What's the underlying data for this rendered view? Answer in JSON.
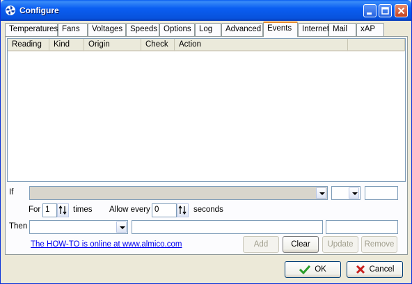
{
  "window": {
    "title": "Configure"
  },
  "tabs": [
    {
      "label": "Temperatures"
    },
    {
      "label": "Fans"
    },
    {
      "label": "Voltages"
    },
    {
      "label": "Speeds"
    },
    {
      "label": "Options"
    },
    {
      "label": "Log"
    },
    {
      "label": "Advanced"
    },
    {
      "label": "Events",
      "active": true
    },
    {
      "label": "Internet"
    },
    {
      "label": "Mail"
    },
    {
      "label": "xAP"
    }
  ],
  "list": {
    "columns": [
      "Reading",
      "Kind",
      "Origin",
      "Check",
      "Action"
    ]
  },
  "if_row": {
    "label": "If"
  },
  "for_row": {
    "for_label": "For",
    "for_value": "1",
    "times_label": "times",
    "allow_label": "Allow every",
    "allow_value": "0",
    "seconds_label": "seconds"
  },
  "then_row": {
    "label": "Then"
  },
  "howto_link": "The HOW-TO is online at www.almico.com",
  "buttons": {
    "add": "Add",
    "clear": "Clear",
    "update": "Update",
    "remove": "Remove",
    "ok": "OK",
    "cancel": "Cancel"
  },
  "colors": {
    "titlebar": "#0a5ef2",
    "tab_active_accent": "#e68b2c",
    "link": "#0000ee",
    "ok_check": "#2a9d2a",
    "cancel_x": "#c8201e"
  }
}
